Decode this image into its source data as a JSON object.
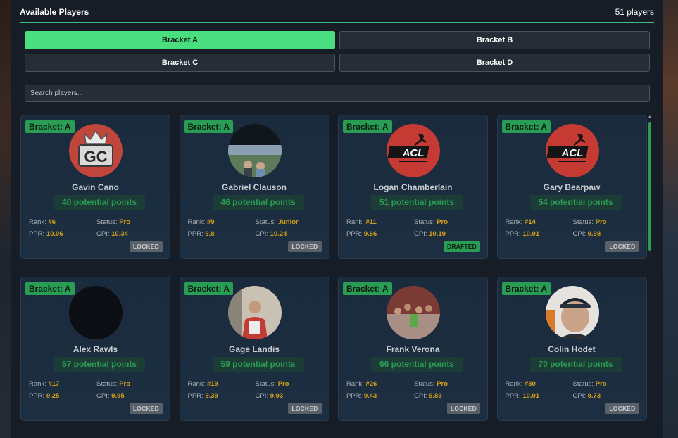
{
  "header": {
    "title": "Available Players",
    "count": "51 players"
  },
  "brackets": [
    "Bracket A",
    "Bracket B",
    "Bracket C",
    "Bracket D"
  ],
  "active_bracket": "Bracket A",
  "search": {
    "placeholder": "Search players..."
  },
  "labels": {
    "rank": "Rank:",
    "status": "Status:",
    "ppr": "PPR:",
    "cpi": "CPI:"
  },
  "colors": {
    "accent": "#4ade80",
    "badge": "#2a9d55",
    "gold": "#d4a017",
    "locked": "#5a6068"
  },
  "players": [
    {
      "bracket": "Bracket: A",
      "name": "Gavin Cano",
      "points": "40 potential points",
      "rank": "#6",
      "status": "Pro",
      "ppr": "10.06",
      "cpi": "10.34",
      "state": "LOCKED",
      "avatar_icon": "gc-logo-icon"
    },
    {
      "bracket": "Bracket: A",
      "name": "Gabriel Clauson",
      "points": "46 potential points",
      "rank": "#9",
      "status": "Junior",
      "ppr": "9.8",
      "cpi": "10.24",
      "state": "LOCKED",
      "avatar_icon": "photo-outdoor-icon"
    },
    {
      "bracket": "Bracket: A",
      "name": "Logan Chamberlain",
      "points": "51 potential points",
      "rank": "#11",
      "status": "Pro",
      "ppr": "9.66",
      "cpi": "10.19",
      "state": "DRAFTED",
      "avatar_icon": "acl-logo-icon"
    },
    {
      "bracket": "Bracket: A",
      "name": "Gary Bearpaw",
      "points": "54 potential points",
      "rank": "#14",
      "status": "Pro",
      "ppr": "10.01",
      "cpi": "9.98",
      "state": "LOCKED",
      "avatar_icon": "acl-logo-icon"
    },
    {
      "bracket": "Bracket: A",
      "name": "Alex Rawls",
      "points": "57 potential points",
      "rank": "#17",
      "status": "Pro",
      "ppr": "9.25",
      "cpi": "9.95",
      "state": "LOCKED",
      "avatar_icon": "blank-avatar-icon"
    },
    {
      "bracket": "Bracket: A",
      "name": "Gage Landis",
      "points": "59 potential points",
      "rank": "#19",
      "status": "Pro",
      "ppr": "9.39",
      "cpi": "9.93",
      "state": "LOCKED",
      "avatar_icon": "photo-person-icon"
    },
    {
      "bracket": "Bracket: A",
      "name": "Frank Verona",
      "points": "66 potential points",
      "rank": "#26",
      "status": "Pro",
      "ppr": "9.43",
      "cpi": "9.83",
      "state": "LOCKED",
      "avatar_icon": "photo-crowd-icon"
    },
    {
      "bracket": "Bracket: A",
      "name": "Colin Hodet",
      "points": "70 potential points",
      "rank": "#30",
      "status": "Pro",
      "ppr": "10.01",
      "cpi": "9.73",
      "state": "LOCKED",
      "avatar_icon": "photo-selfie-icon"
    }
  ]
}
